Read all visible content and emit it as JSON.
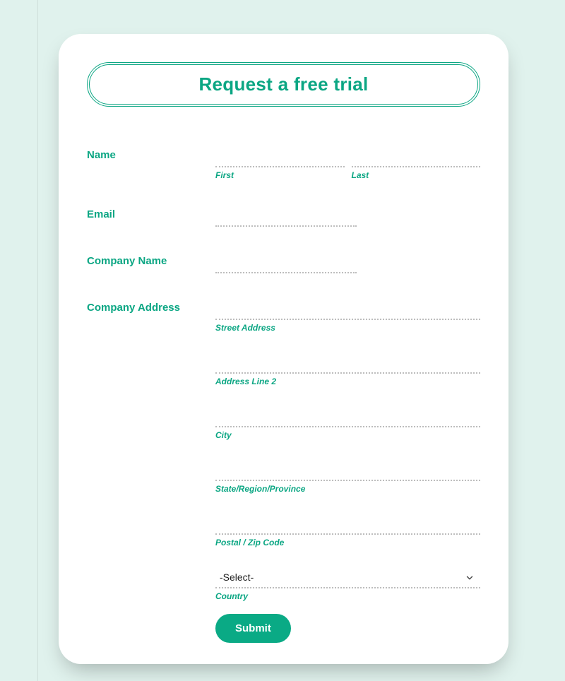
{
  "colors": {
    "accent": "#0ba683",
    "button": "#0aaa85"
  },
  "title": "Request a free trial",
  "form": {
    "name": {
      "label": "Name",
      "first": {
        "sub": "First",
        "value": ""
      },
      "last": {
        "sub": "Last",
        "value": ""
      }
    },
    "email": {
      "label": "Email",
      "value": ""
    },
    "company_name": {
      "label": "Company Name",
      "value": ""
    },
    "address": {
      "label": "Company Address",
      "street": {
        "sub": "Street Address",
        "value": ""
      },
      "line2": {
        "sub": "Address Line 2",
        "value": ""
      },
      "city": {
        "sub": "City",
        "value": ""
      },
      "state": {
        "sub": "State/Region/Province",
        "value": ""
      },
      "postal": {
        "sub": "Postal / Zip Code",
        "value": ""
      },
      "country": {
        "sub": "Country",
        "selected": "-Select-"
      }
    },
    "submit_label": "Submit"
  }
}
